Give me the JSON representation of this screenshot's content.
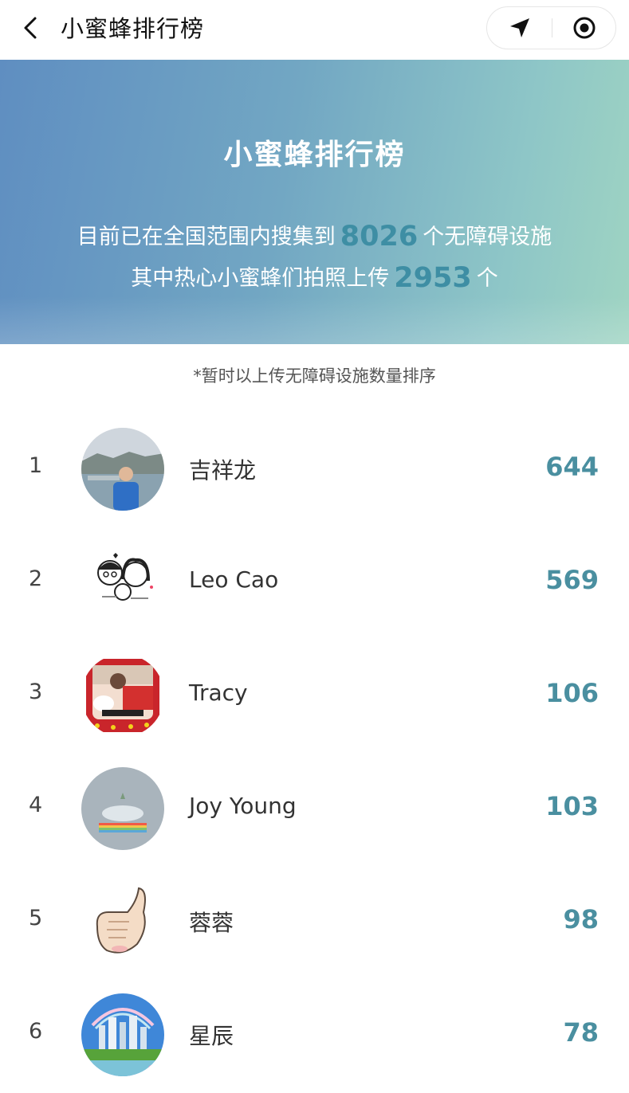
{
  "nav": {
    "title": "小蜜蜂排行榜",
    "back_icon": "chevron-left-icon",
    "capsule_left_icon": "navigation-arrow-icon",
    "capsule_right_icon": "target-circle-icon"
  },
  "hero": {
    "title": "小蜜蜂排行榜",
    "line1_prefix": "目前已在全国范围内搜集到",
    "facilities_count": "8026",
    "line1_suffix": "个无障碍设施",
    "line2_prefix": "其中热心小蜜蜂们拍照上传",
    "uploads_count": "2953",
    "line2_suffix": "个",
    "gradient_start": "#5f8ec1",
    "gradient_end": "#9fd4c2",
    "accent_number_color": "#3e8ea4"
  },
  "note": "*暂时以上传无障碍设施数量排序",
  "ranking": [
    {
      "rank": "1",
      "name": "吉祥龙",
      "score": "644"
    },
    {
      "rank": "2",
      "name": "Leo Cao",
      "score": "569"
    },
    {
      "rank": "3",
      "name": "Tracy",
      "score": "106"
    },
    {
      "rank": "4",
      "name": "Joy Young",
      "score": "103"
    },
    {
      "rank": "5",
      "name": "蓉蓉",
      "score": "98"
    },
    {
      "rank": "6",
      "name": "星辰",
      "score": "78"
    }
  ],
  "colors": {
    "score": "#4a8fa0"
  }
}
